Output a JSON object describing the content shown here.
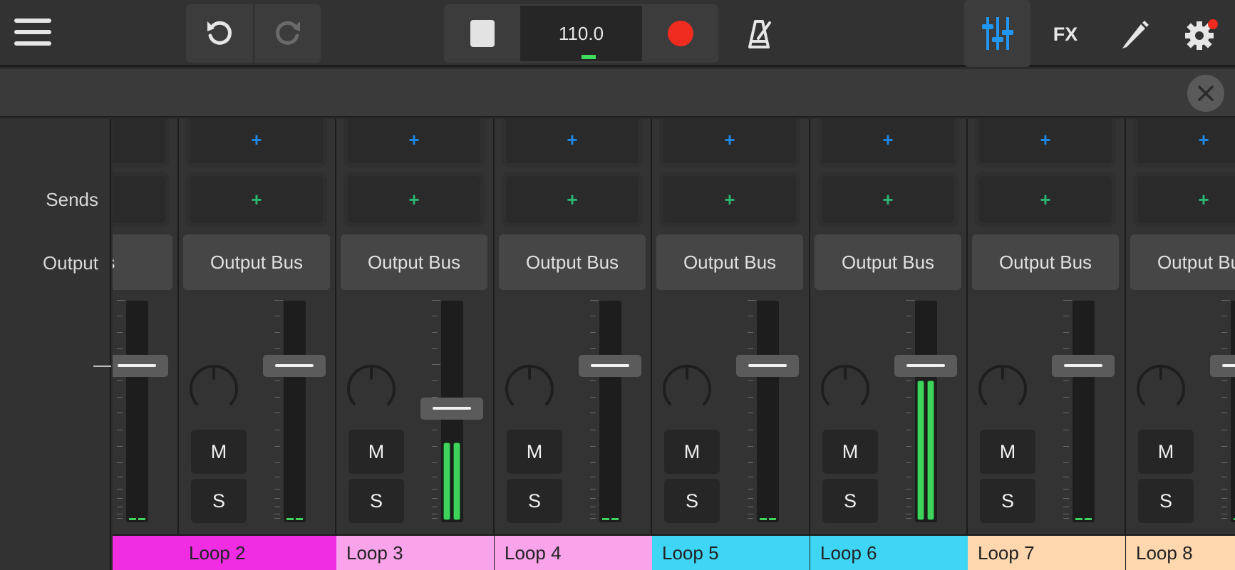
{
  "toolbar": {
    "tempo": "110.0",
    "fx_label": "FX",
    "icons": [
      "menu-icon",
      "undo-icon",
      "redo-icon",
      "stop-icon",
      "record-icon",
      "metronome-icon",
      "mixer-icon",
      "pencil-icon",
      "gear-icon",
      "close-icon"
    ],
    "record_color": "#f02b1f",
    "accent_color": "#2196f3"
  },
  "labels": {
    "sends": "Sends",
    "output": "Output"
  },
  "channels": [
    {
      "name": "",
      "output": "Bus",
      "color": "#f02de3",
      "fader_db_level": 0.0,
      "meter": 0
    },
    {
      "name": "Loop 2",
      "output": "Output Bus",
      "color": "#f02de3",
      "fader_db_level": 0.0,
      "meter": 0
    },
    {
      "name": "Loop 3",
      "output": "Output Bus",
      "color": "#f9a3ea",
      "fader_db_level": -0.2,
      "meter": 0.35
    },
    {
      "name": "Loop 4",
      "output": "Output Bus",
      "color": "#f9a3ea",
      "fader_db_level": 0.0,
      "meter": 0
    },
    {
      "name": "Loop 5",
      "output": "Output Bus",
      "color": "#3fd6f5",
      "fader_db_level": 0.0,
      "meter": 0
    },
    {
      "name": "Loop 6",
      "output": "Output Bus",
      "color": "#3fd6f5",
      "fader_db_level": 0.0,
      "meter": 0.63
    },
    {
      "name": "Loop 7",
      "output": "Output Bus",
      "color": "#ffd7ae",
      "fader_db_level": 0.0,
      "meter": 0
    },
    {
      "name": "Loop 8",
      "output": "Output Bus",
      "color": "#ffd7ae",
      "fader_db_level": 0.0,
      "meter": 0
    }
  ],
  "strip_buttons": {
    "mute": "M",
    "solo": "S",
    "slot_plus": "+"
  }
}
